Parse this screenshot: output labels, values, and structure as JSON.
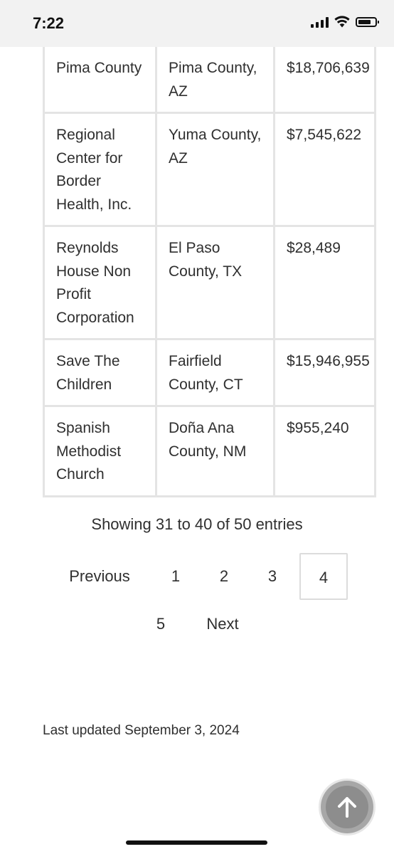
{
  "status_bar": {
    "time": "7:22",
    "icons": [
      "cellular-signal-icon",
      "wifi-icon",
      "battery-icon"
    ]
  },
  "table": {
    "rows": [
      {
        "recipient": "Pima County",
        "location": "Pima County, AZ",
        "amount": "$18,706,639"
      },
      {
        "recipient": "Regional Center for Border Health, Inc.",
        "location": "Yuma County, AZ",
        "amount": "$7,545,622"
      },
      {
        "recipient": "Reynolds House Non Profit Corporation",
        "location": "El Paso County, TX",
        "amount": "$28,489"
      },
      {
        "recipient": "Save The Children",
        "location": "Fairfield County, CT",
        "amount": "$15,946,955"
      },
      {
        "recipient": "Spanish Methodist Church",
        "location": "Doña Ana County, NM",
        "amount": "$955,240"
      }
    ]
  },
  "info": {
    "showing": "Showing 31 to 40 of 50 entries"
  },
  "pagination": {
    "previous": "Previous",
    "pages": [
      "1",
      "2",
      "3",
      "4",
      "5"
    ],
    "current": "4",
    "next": "Next"
  },
  "footer": {
    "last_updated": "Last updated September 3, 2024"
  },
  "scroll_top": {
    "icon": "arrow-up-icon"
  },
  "colors": {
    "status_bar_bg": "#f2f2f2",
    "table_border": "#e4e4e4",
    "text": "#2f2f2f",
    "scroll_button": "#8d8d8d"
  }
}
